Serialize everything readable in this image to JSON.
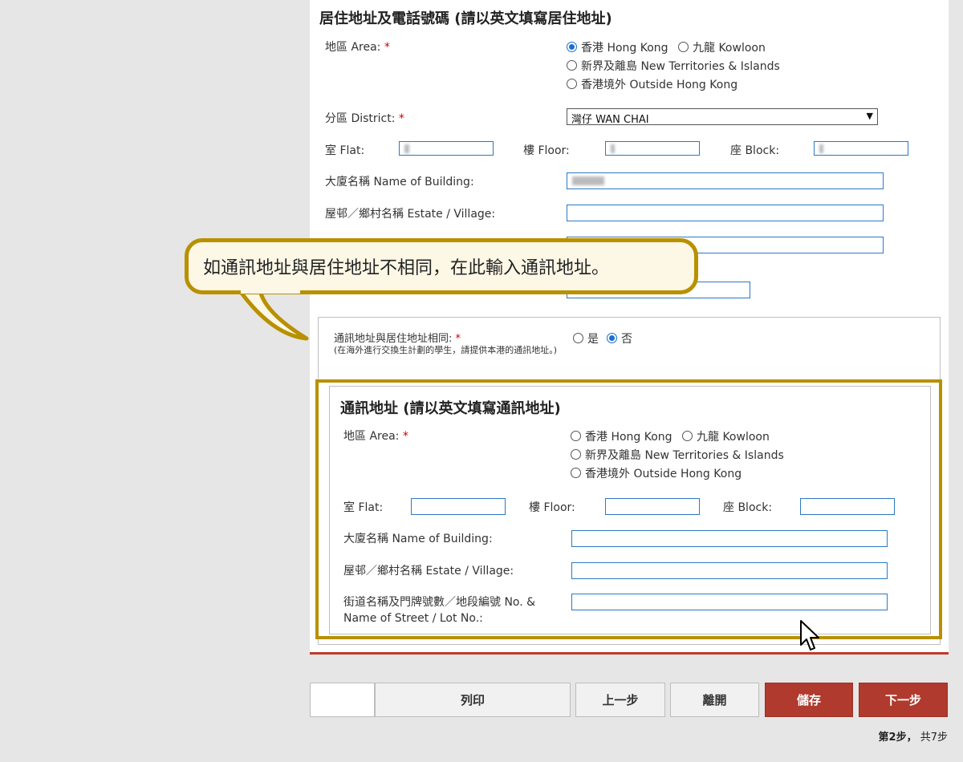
{
  "residential": {
    "title": "居住地址及電話號碼 (請以英文填寫居住地址)",
    "area_label": "地區 Area:",
    "area_options": [
      "香港 Hong Kong",
      "九龍 Kowloon",
      "新界及離島 New Territories & Islands",
      "香港境外 Outside Hong Kong"
    ],
    "area_selected": "香港 Hong Kong",
    "district_label": "分區 District:",
    "district_value": "灣仔 WAN CHAI",
    "flat_label": "室 Flat:",
    "floor_label": "樓 Floor:",
    "block_label": "座 Block:",
    "building_label": "大廈名稱 Name of Building:",
    "estate_label": "屋邨／鄉村名稱 Estate / Village:"
  },
  "same_address": {
    "label": "通訊地址與居住地址相同:",
    "note": "(在海外進行交換生計劃的學生，請提供本港的通訊地址。)",
    "options": [
      "是",
      "否"
    ],
    "selected": "否"
  },
  "correspondence": {
    "title": "通訊地址 (請以英文填寫通訊地址)",
    "area_label": "地區 Area:",
    "area_options": [
      "香港 Hong Kong",
      "九龍 Kowloon",
      "新界及離島 New Territories & Islands",
      "香港境外 Outside Hong Kong"
    ],
    "flat_label": "室 Flat:",
    "floor_label": "樓 Floor:",
    "block_label": "座 Block:",
    "building_label": "大廈名稱 Name of Building:",
    "estate_label": "屋邨／鄉村名稱 Estate / Village:",
    "street_label_1": "街道名稱及門牌號數／地段編號 No. &",
    "street_label_2": "Name of Street / Lot No.:"
  },
  "required_mark": "*",
  "callout": "如通訊地址與居住地址不相同，在此輸入通訊地址。",
  "buttons": {
    "print": "列印",
    "prev": "上一步",
    "leave": "離開",
    "save": "儲存",
    "next": "下一步"
  },
  "step": {
    "current": "第2步，",
    "total": "共7步"
  },
  "colors": {
    "accent_red": "#b03a2e",
    "highlight_gold": "#b89000",
    "field_border": "#2b79c2"
  }
}
